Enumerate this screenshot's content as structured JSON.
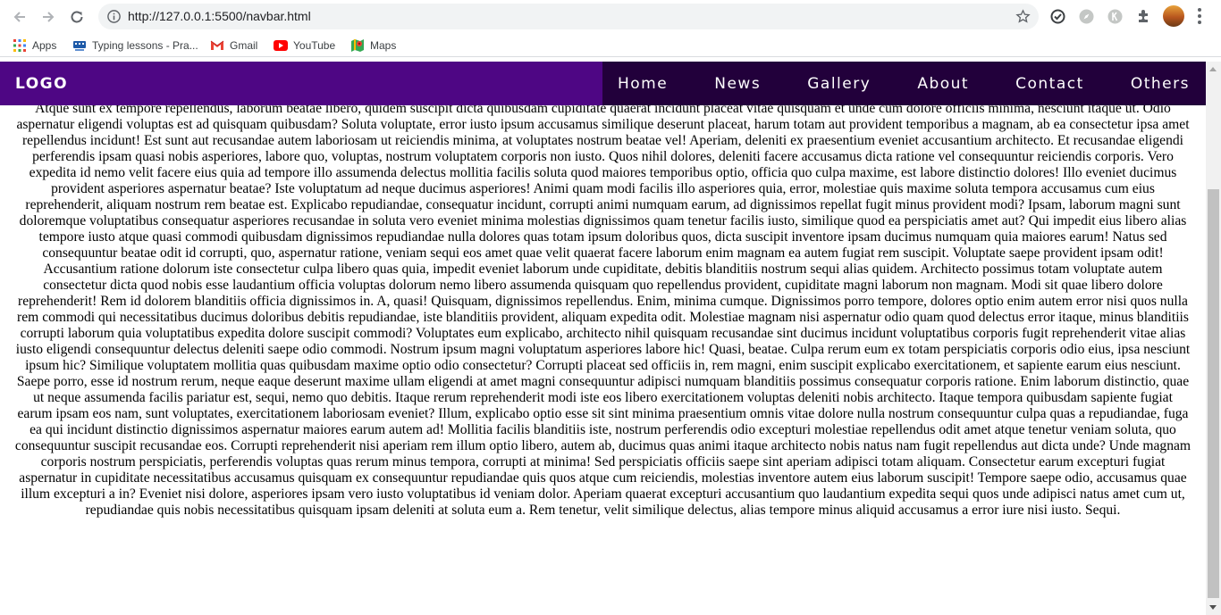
{
  "browser": {
    "url": "http://127.0.0.1:5500/navbar.html",
    "bookmarks": [
      {
        "label": "Apps",
        "icon": "apps-grid-icon"
      },
      {
        "label": "Typing lessons - Pra...",
        "icon": "typing-icon"
      },
      {
        "label": "Gmail",
        "icon": "gmail-icon"
      },
      {
        "label": "YouTube",
        "icon": "youtube-icon"
      },
      {
        "label": "Maps",
        "icon": "maps-icon"
      }
    ]
  },
  "navbar": {
    "logo": "LOGO",
    "links": [
      "Home",
      "News",
      "Gallery",
      "About",
      "Contact",
      "Others"
    ],
    "colors": {
      "brand_bg": "#4e0684",
      "links_bg": "#22003b",
      "text": "#ffffff"
    }
  },
  "content": {
    "text": "Lorem ipsum dolor sit amet consectetur adipisicing elit. Accusamus provident, adipisci, possimus maiores dignissimos autem tempora itaque id. Dolor voluptate, aliquid natus doloribus totam iusto illo explicabo provident laudantium veniam nesciunt qui? Alias sunt facere dolor vero doloremque incidunt reprehenderit sint cupiditate, corrupti ex. Nesciunt at aspernatur vel deserunt, neque voluptatibus cumque quisquam quas, reprehenderit minima culpa. Atque molestias hic in molestiae perferendis. Impedit voluptatem temporibus reiciendis laboriosam. Magnam ipsa ipsum beatae non vel officia soluta quia eligendi eaque. Atque sunt ex tempore repellendus, laborum beatae libero, quidem suscipit dicta quibusdam cupiditate quaerat incidunt placeat vitae quisquam et unde cum dolore officiis minima, nesciunt itaque ut. Odio aspernatur eligendi voluptas est ad quisquam quibusdam? Soluta voluptate, error iusto ipsum accusamus similique deserunt placeat, harum totam aut provident temporibus a magnam, ab ea consectetur ipsa amet repellendus incidunt! Est sunt aut recusandae autem laboriosam ut reiciendis minima, at voluptates nostrum beatae vel! Aperiam, deleniti ex praesentium eveniet accusantium architecto. Et recusandae eligendi perferendis ipsam quasi nobis asperiores, labore quo, voluptas, nostrum voluptatem corporis non iusto. Quos nihil dolores, deleniti facere accusamus dicta ratione vel consequuntur reiciendis corporis. Vero expedita id nemo velit facere eius quia ad tempore illo assumenda delectus mollitia facilis soluta quod maiores temporibus optio, officia quo culpa maxime, est labore distinctio dolores! Illo eveniet ducimus provident asperiores aspernatur beatae? Iste voluptatum ad neque ducimus asperiores! Animi quam modi facilis illo asperiores quia, error, molestiae quis maxime soluta tempora accusamus cum eius reprehenderit, aliquam nostrum rem beatae est. Explicabo repudiandae, consequatur incidunt, corrupti animi numquam earum, ad dignissimos repellat fugit minus provident modi? Ipsam, laborum magni sunt doloremque voluptatibus consequatur asperiores recusandae in soluta vero eveniet minima molestias dignissimos quam tenetur facilis iusto, similique quod ea perspiciatis amet aut? Qui impedit eius libero alias tempore iusto atque quasi commodi quibusdam dignissimos repudiandae nulla dolores quas totam ipsum doloribus quos, dicta suscipit inventore ipsam ducimus numquam quia maiores earum! Natus sed consequuntur beatae odit id corrupti, quo, aspernatur ratione, veniam sequi eos amet quae velit quaerat facere laborum enim magnam ea autem fugiat rem suscipit. Voluptate saepe provident ipsam odit! Accusantium ratione dolorum iste consectetur culpa libero quas quia, impedit eveniet laborum unde cupiditate, debitis blanditiis nostrum sequi alias quidem. Architecto possimus totam voluptate autem consectetur dicta quod nobis esse laudantium officia voluptas dolorum nemo libero assumenda quisquam quo repellendus provident, cupiditate magni laborum non magnam. Modi sit quae libero dolore reprehenderit! Rem id dolorem blanditiis officia dignissimos in. A, quasi! Quisquam, dignissimos repellendus. Enim, minima cumque. Dignissimos porro tempore, dolores optio enim autem error nisi quos nulla rem commodi qui necessitatibus ducimus doloribus debitis repudiandae, iste blanditiis provident, aliquam expedita odit. Molestiae magnam nisi aspernatur odio quam quod delectus error itaque, minus blanditiis corrupti laborum quia voluptatibus expedita dolore suscipit commodi? Voluptates eum explicabo, architecto nihil quisquam recusandae sint ducimus incidunt voluptatibus corporis fugit reprehenderit vitae alias iusto eligendi consequuntur delectus deleniti saepe odio commodi. Nostrum ipsum magni voluptatum asperiores labore hic! Quasi, beatae. Culpa rerum eum ex totam perspiciatis corporis odio eius, ipsa nesciunt ipsum hic? Similique voluptatem mollitia quas quibusdam maxime optio odio consectetur? Corrupti placeat sed officiis in, rem magni, enim suscipit explicabo exercitationem, et sapiente earum eius nesciunt. Saepe porro, esse id nostrum rerum, neque eaque deserunt maxime ullam eligendi at amet magni consequuntur adipisci numquam blanditiis possimus consequatur corporis ratione. Enim laborum distinctio, quae ut neque assumenda facilis pariatur est, sequi, nemo quo debitis. Itaque rerum reprehenderit modi iste eos libero exercitationem voluptas deleniti nobis architecto. Itaque tempora quibusdam sapiente fugiat earum ipsam eos nam, sunt voluptates, exercitationem laboriosam eveniet? Illum, explicabo optio esse sit sint minima praesentium omnis vitae dolore nulla nostrum consequuntur culpa quas a repudiandae, fuga ea qui incidunt distinctio dignissimos aspernatur maiores earum autem ad! Mollitia facilis blanditiis iste, nostrum perferendis odio excepturi molestiae repellendus odit amet atque tenetur veniam soluta, quo consequuntur suscipit recusandae eos. Corrupti reprehenderit nisi aperiam rem illum optio libero, autem ab, ducimus quas animi itaque architecto nobis natus nam fugit repellendus aut dicta unde? Unde magnam corporis nostrum perspiciatis, perferendis voluptas quas rerum minus tempora, corrupti at minima! Sed perspiciatis officiis saepe sint aperiam adipisci totam aliquam. Consectetur earum excepturi fugiat aspernatur in cupiditate necessitatibus accusamus quisquam ex consequuntur repudiandae quis quos atque cum reiciendis, molestias inventore autem eius laborum suscipit! Tempore saepe odio, accusamus quae illum excepturi a in? Eveniet nisi dolore, asperiores ipsam vero iusto voluptatibus id veniam dolor. Aperiam quaerat excepturi accusantium quo laudantium expedita sequi quos unde adipisci natus amet cum ut, repudiandae quis nobis necessitatibus quisquam ipsam deleniti at soluta eum a. Rem tenetur, velit similique delectus, alias tempore minus aliquid accusamus a error iure nisi iusto. Sequi."
  }
}
